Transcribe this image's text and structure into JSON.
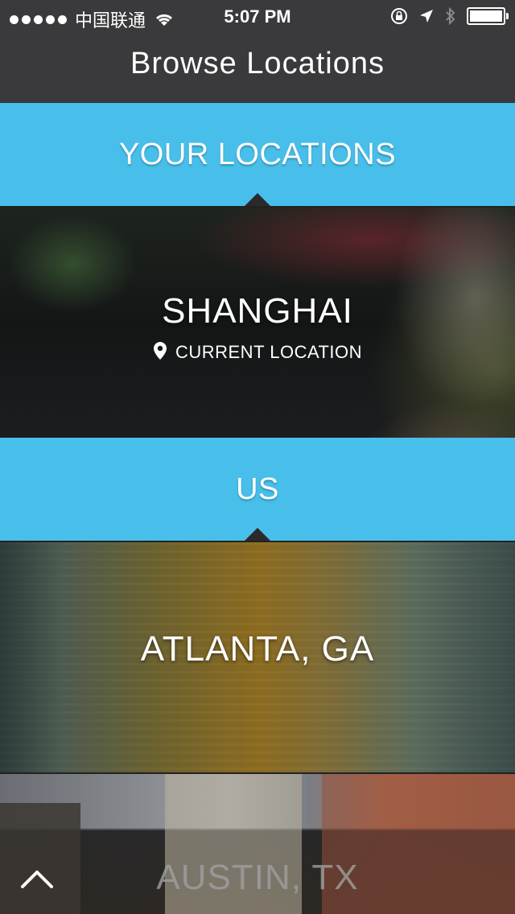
{
  "status_bar": {
    "carrier": "中国联通",
    "time": "5:07 PM"
  },
  "nav": {
    "title": "Browse Locations"
  },
  "sections": [
    {
      "label": "YOUR LOCATIONS",
      "cities": [
        {
          "name": "SHANGHAI",
          "subtitle": "CURRENT LOCATION",
          "subtitle_icon": "location-pin-icon"
        }
      ]
    },
    {
      "label": "US",
      "cities": [
        {
          "name": "ATLANTA, GA"
        },
        {
          "name": "AUSTIN, TX"
        }
      ]
    }
  ],
  "icons": {
    "scroll_up": "chevron-up-icon"
  },
  "colors": {
    "nav_bg": "#3a393b",
    "section_bg": "#48bfea",
    "text": "#ffffff"
  }
}
